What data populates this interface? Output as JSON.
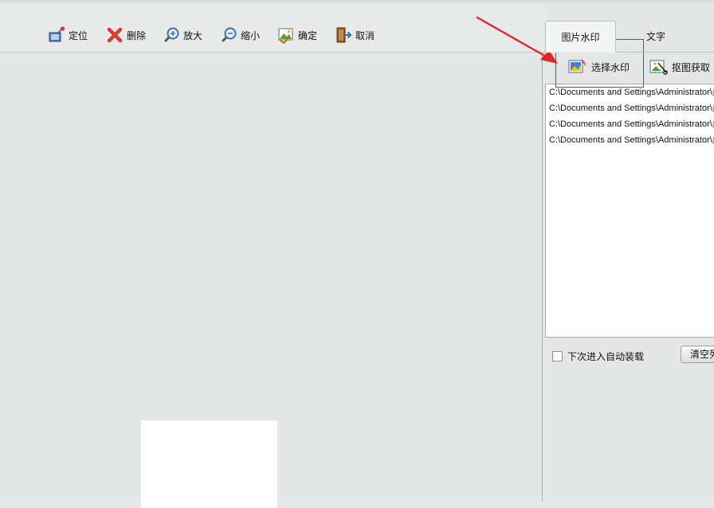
{
  "toolbar": {
    "locate_label": "定位",
    "delete_label": "删除",
    "zoom_in_label": "放大",
    "zoom_out_label": "缩小",
    "confirm_label": "确定",
    "cancel_label": "取消"
  },
  "tabs": {
    "image_watermark_label": "图片水印",
    "text_label": "文字"
  },
  "watermark_panel": {
    "select_watermark_label": "选择水印",
    "capture_image_label": "抠图获取",
    "files": [
      "C:\\Documents and Settings\\Administrator\\桌",
      "C:\\Documents and Settings\\Administrator\\桌",
      "C:\\Documents and Settings\\Administrator\\桌",
      "C:\\Documents and Settings\\Administrator\\桌"
    ],
    "auto_load_label": "下次进入自动装载",
    "clear_label": "清空列表"
  },
  "icons": {
    "locate": "pin-icon",
    "delete": "red-x-icon",
    "zoom_in": "magnifier-plus-icon",
    "zoom_out": "magnifier-minus-icon",
    "confirm": "picture-check-icon",
    "cancel": "door-exit-icon",
    "select_watermark": "image-watermark-icon",
    "capture_image": "crop-image-icon"
  },
  "colors": {
    "annotation_red": "#e0262c",
    "panel_background": "#e4e7e6",
    "list_background": "#ffffff"
  }
}
